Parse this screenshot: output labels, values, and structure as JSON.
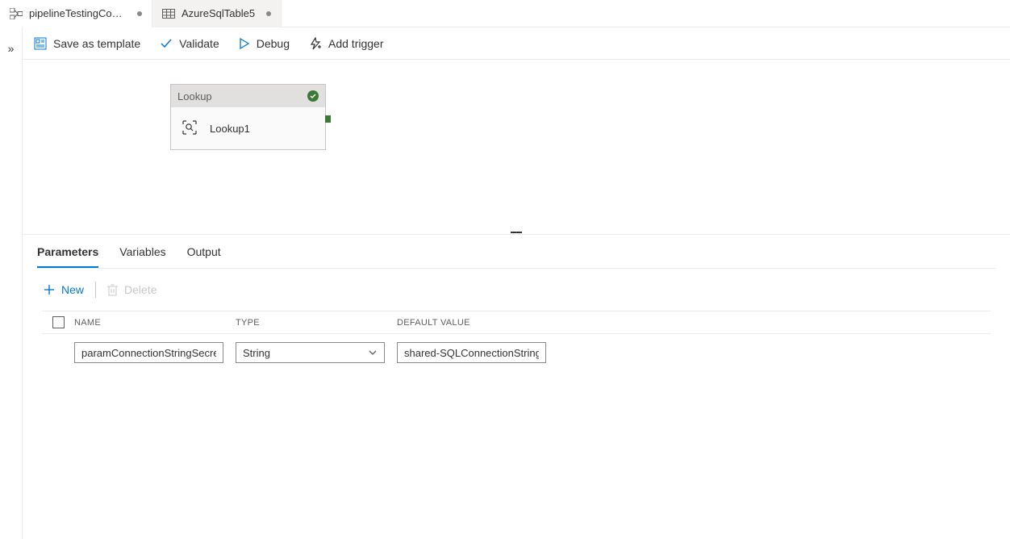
{
  "tabs": [
    {
      "title": "pipelineTestingCom…",
      "dirty": true,
      "icon": "pipeline"
    },
    {
      "title": "AzureSqlTable5",
      "dirty": true,
      "icon": "table"
    }
  ],
  "toolbar": {
    "save_template": "Save as template",
    "validate": "Validate",
    "debug": "Debug",
    "add_trigger": "Add trigger"
  },
  "canvas": {
    "activity_type": "Lookup",
    "activity_name": "Lookup1"
  },
  "lower_tabs": {
    "parameters": "Parameters",
    "variables": "Variables",
    "output": "Output",
    "active": "parameters"
  },
  "actions": {
    "new": "New",
    "delete": "Delete"
  },
  "columns": {
    "name": "NAME",
    "type": "TYPE",
    "default": "DEFAULT VALUE"
  },
  "rows": [
    {
      "name": "paramConnectionStringSecret",
      "type": "String",
      "default": "shared-SQLConnectionString-k"
    }
  ]
}
